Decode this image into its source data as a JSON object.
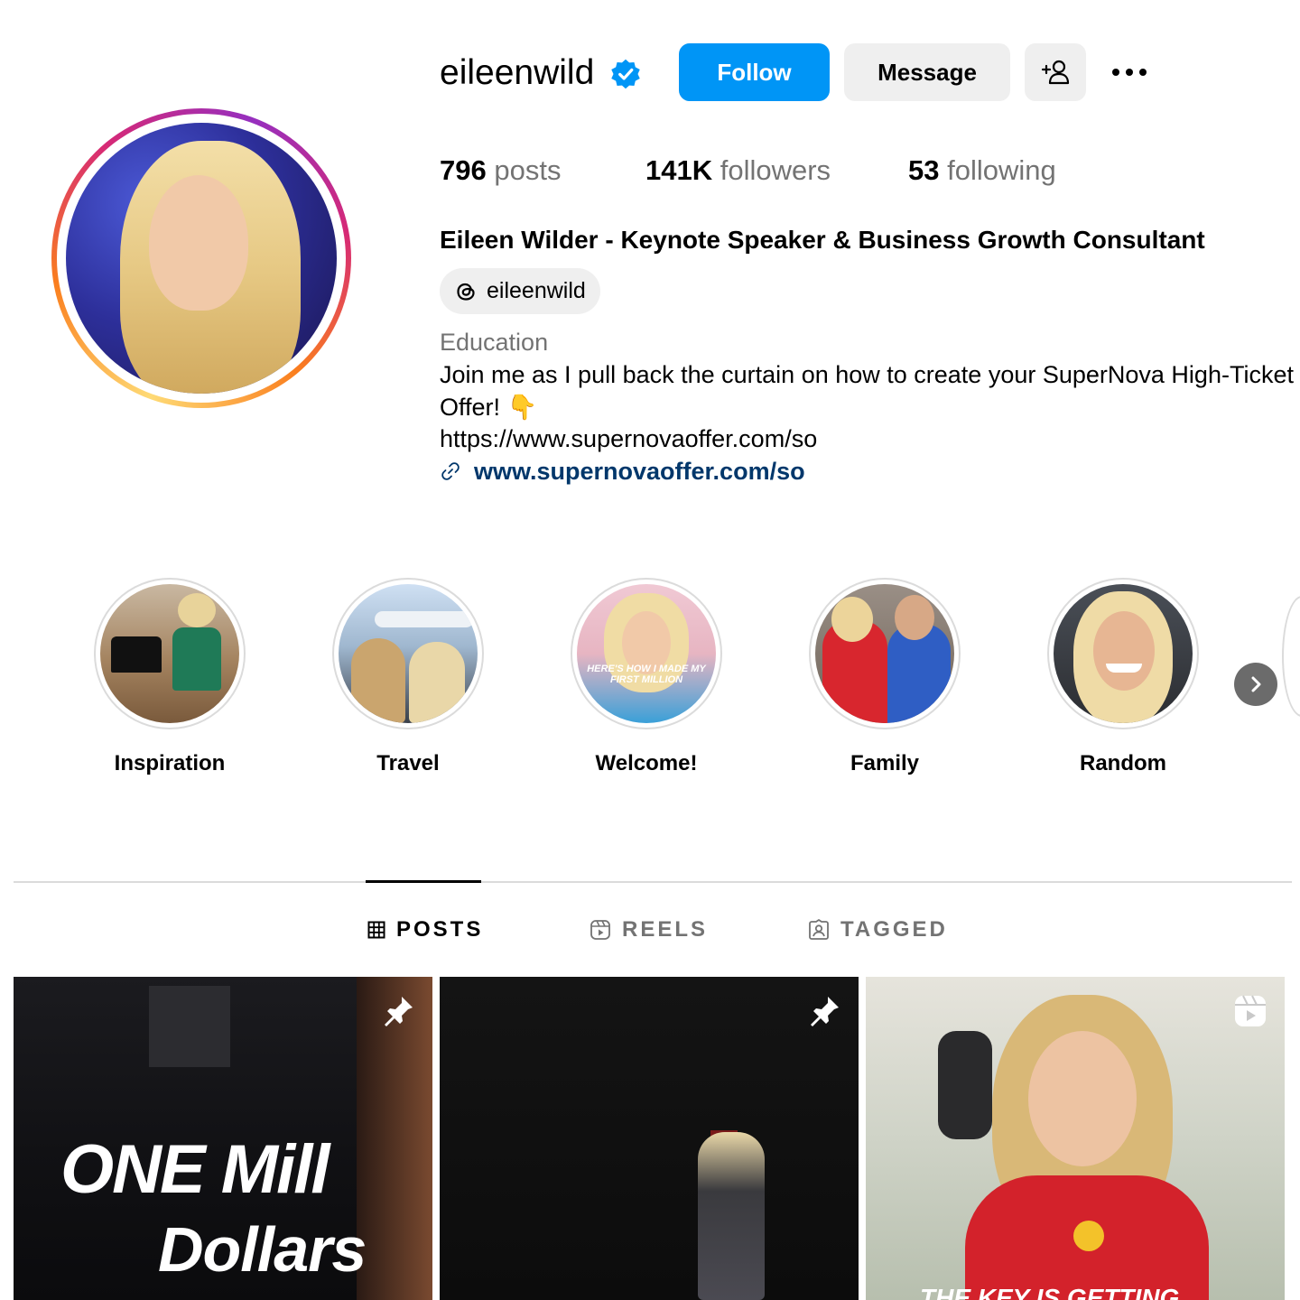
{
  "profile": {
    "username": "eileenwild",
    "full_name": "Eileen Wilder - Keynote Speaker & Business Growth Consultant",
    "threads_handle": "eileenwild",
    "category": "Education",
    "bio": "Join me as I pull back the curtain on how to create your SuperNova High-Ticket Offer! 👇",
    "bio_link_text": "https://www.supernovaoffer.com/so",
    "external_link": "www.supernovaoffer.com/so",
    "verified": true
  },
  "actions": {
    "follow_label": "Follow",
    "message_label": "Message",
    "add_user_icon": "add-person-icon",
    "more_icon": "more-options-icon"
  },
  "stats": {
    "posts_count": "796",
    "posts_label": "posts",
    "followers_count": "141K",
    "followers_label": "followers",
    "following_count": "53",
    "following_label": "following"
  },
  "highlights": [
    {
      "label": "Inspiration"
    },
    {
      "label": "Travel"
    },
    {
      "label": "Welcome!"
    },
    {
      "label": "Family"
    },
    {
      "label": "Random"
    }
  ],
  "highlight_overlay_text": "HERE'S HOW I MADE MY FIRST MILLION",
  "tabs": [
    {
      "label": "POSTS",
      "icon": "grid-icon",
      "active": true
    },
    {
      "label": "REELS",
      "icon": "reels-icon",
      "active": false
    },
    {
      "label": "TAGGED",
      "icon": "tagged-icon",
      "active": false
    }
  ],
  "posts": [
    {
      "overlay_line1": "ONE Mill",
      "overlay_line2": "Dollars",
      "icon": "pin-icon"
    },
    {
      "overlay_line1": "",
      "overlay_line2": "",
      "icon": "pin-icon"
    },
    {
      "overlay_line1": "THE KEY IS GETTING",
      "overlay_line2": "",
      "icon": "reels-icon"
    }
  ],
  "colors": {
    "primary_button": "#0095f6",
    "secondary_button": "#efefef",
    "link": "#00376b",
    "muted_text": "#737373",
    "verified": "#0095f6"
  }
}
